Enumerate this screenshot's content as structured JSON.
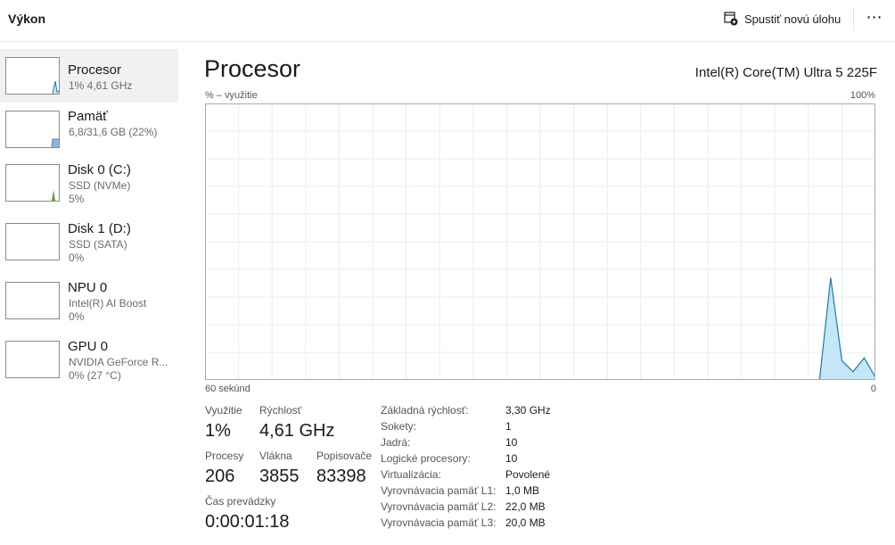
{
  "header": {
    "title": "Výkon",
    "run_task_label": "Spustiť novú úlohu",
    "more_label": "⋯"
  },
  "sidebar": {
    "items": [
      {
        "name": "Procesor",
        "line1": "1% 4,61 GHz",
        "line2": "",
        "selected": true
      },
      {
        "name": "Pamäť",
        "line1": "6,8/31,6 GB (22%)",
        "line2": ""
      },
      {
        "name": "Disk 0 (C:)",
        "line1": "SSD (NVMe)",
        "line2": "5%"
      },
      {
        "name": "Disk 1 (D:)",
        "line1": "SSD (SATA)",
        "line2": "0%"
      },
      {
        "name": "NPU 0",
        "line1": "Intel(R) AI Boost",
        "line2": "0%"
      },
      {
        "name": "GPU 0",
        "line1": "NVIDIA GeForce R...",
        "line2": "0% (27 °C)"
      }
    ]
  },
  "main": {
    "title": "Procesor",
    "cpu_model": "Intel(R) Core(TM) Ultra 5 225F",
    "y_axis_label": "% – využitie",
    "y_axis_max": "100%",
    "x_axis_left": "60 sekúnd",
    "x_axis_right": "0"
  },
  "colors": {
    "cpu_line": "#1c7cb0",
    "cpu_fill": "#c4e6f6",
    "grid": "#e4eef4",
    "graph_border": "#a9a9a9",
    "memory_fill": "#8ab6e0",
    "disk_fill": "#5a9e3c"
  },
  "stats": {
    "utilization_label": "Využitie",
    "utilization_value": "1%",
    "speed_label": "Rýchlosť",
    "speed_value": "4,61 GHz",
    "processes_label": "Procesy",
    "processes_value": "206",
    "threads_label": "Vlákna",
    "threads_value": "3855",
    "handles_label": "Popisovače",
    "handles_value": "83398",
    "uptime_label": "Čas prevádzky",
    "uptime_value": "0:00:01:18"
  },
  "specs": [
    {
      "label": "Základná rýchlosť:",
      "value": "3,30 GHz"
    },
    {
      "label": "Sokety:",
      "value": "1"
    },
    {
      "label": "Jadrá:",
      "value": "10"
    },
    {
      "label": "Logické procesory:",
      "value": "10"
    },
    {
      "label": "Virtualizácia:",
      "value": "Povolené"
    },
    {
      "label": "Vyrovnávacia pamäť L1:",
      "value": "1,0 MB"
    },
    {
      "label": "Vyrovnávacia pamäť L2:",
      "value": "22,0 MB"
    },
    {
      "label": "Vyrovnávacia pamäť L3:",
      "value": "20,0 MB"
    }
  ],
  "chart_data": {
    "type": "area",
    "x_range_seconds": [
      60,
      0
    ],
    "ylim": [
      0,
      100
    ],
    "grid": true,
    "x": [
      60,
      5,
      4,
      3,
      2,
      1,
      0
    ],
    "values": [
      0,
      0,
      37,
      7,
      3,
      8,
      1
    ]
  }
}
